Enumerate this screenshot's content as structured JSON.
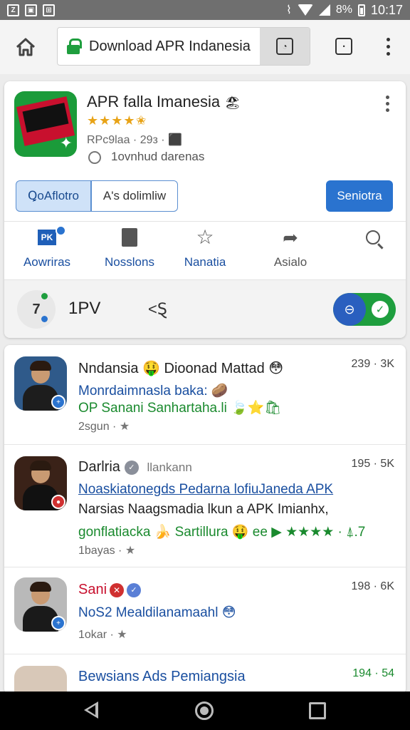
{
  "status_bar": {
    "left_icons": [
      "notification-icon",
      "gallery-icon",
      "screenshot-icon"
    ],
    "battery": "8%",
    "time": "10:17"
  },
  "browser": {
    "url_text": "Download APR Indanesia",
    "icons": [
      "home-icon",
      "lock-icon",
      "tab-action-icon",
      "tabs-icon",
      "menu-icon"
    ]
  },
  "app_card": {
    "title": "APR falla Imanesia",
    "title_emoji": "🏖",
    "rating_stars": "★★★★✬",
    "meta": "RPc9laa · 29з · ⬛",
    "download_label": "1ovnhud darenas",
    "btn_left": "ꝖoAflotro",
    "btn_mid": "A's dolimliw",
    "btn_primary": "Seniotra",
    "nav": [
      {
        "label": "Aowriras",
        "icon": "flag-icon"
      },
      {
        "label": "Nosslons",
        "icon": "bookmark-icon"
      },
      {
        "label": "Nanatia",
        "icon": "star-icon"
      },
      {
        "label": "Asialo",
        "icon": "share-icon"
      },
      {
        "label": "",
        "icon": "search-icon"
      }
    ],
    "footer": {
      "icon_text": "7",
      "text": "1PV",
      "arrow": "<Ȿ"
    }
  },
  "posts": [
    {
      "name": "Nndansia 🤑 Dioonad Mattad 😳",
      "stat": "239 · 3K",
      "line1": "Monrdaimnasla baka: 🥔",
      "line2": "OP Sanani Sanhartaha.li 🍃⭐🛍",
      "meta": "2sgun ·",
      "badge_color": "#2a73cf"
    },
    {
      "name": "Darlria",
      "verified_label": "llankann",
      "stat": "195 · 5K",
      "line1": "Noaskiatonegds Pedarna lofiuJaneda APK",
      "line2": "Narsias Naagsmadia lkun a APK Imianhx,",
      "line3": "gonflatiacka 🍌 Sartillura 🤑 ee ▶ ★★★★ · ⍋.7",
      "meta": "1bayas ·",
      "badge_color": "#d03030"
    },
    {
      "name": "Sani",
      "stat": "198 · 6K",
      "line1": "NoS2 Mealdilanamaahl 😳",
      "meta": "1okar ·",
      "badge_color": "#2a73cf"
    },
    {
      "name": "Bewsians Ads Pemiangsia",
      "stat": "194 · 54"
    }
  ],
  "nav_bar": {
    "icons": [
      "back-icon",
      "home-icon",
      "recents-icon"
    ]
  }
}
